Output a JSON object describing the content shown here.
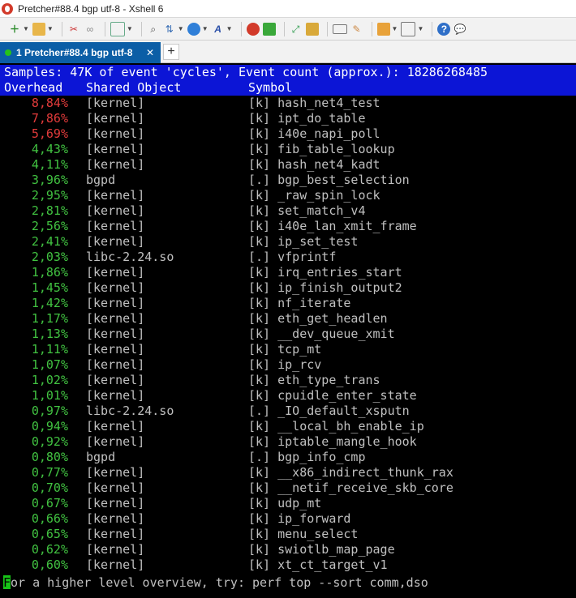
{
  "window": {
    "title": "Pretcher#88.4 bgp  utf-8 - Xshell 6"
  },
  "toolbar": {
    "icons": [
      "new-session",
      "open-folder",
      "disconnect",
      "reconnect",
      "properties",
      "find",
      "transfer",
      "globe",
      "font",
      "xftp",
      "xshell-shell",
      "fullscreen",
      "lock",
      "keyboard",
      "script",
      "new-tab",
      "layout",
      "help",
      "chat"
    ]
  },
  "tabs": [
    {
      "label": "1 Pretcher#88.4 bgp  utf-8",
      "close": "✕"
    }
  ],
  "tab_add": "+",
  "terminal": {
    "samples_line": "Samples: 47K of event 'cycles', Event count (approx.): 18286268485",
    "columns": {
      "overhead": "Overhead",
      "shared_object": "Shared Object",
      "symbol": "Symbol"
    },
    "rows": [
      {
        "pct": "8,84%",
        "obj": "[kernel]",
        "sym": "[k] hash_net4_test",
        "color": "red"
      },
      {
        "pct": "7,86%",
        "obj": "[kernel]",
        "sym": "[k] ipt_do_table",
        "color": "red"
      },
      {
        "pct": "5,69%",
        "obj": "[kernel]",
        "sym": "[k] i40e_napi_poll",
        "color": "red"
      },
      {
        "pct": "4,43%",
        "obj": "[kernel]",
        "sym": "[k] fib_table_lookup",
        "color": "green"
      },
      {
        "pct": "4,11%",
        "obj": "[kernel]",
        "sym": "[k] hash_net4_kadt",
        "color": "green"
      },
      {
        "pct": "3,96%",
        "obj": "bgpd",
        "sym": "[.] bgp_best_selection",
        "color": "green"
      },
      {
        "pct": "2,95%",
        "obj": "[kernel]",
        "sym": "[k] _raw_spin_lock",
        "color": "green"
      },
      {
        "pct": "2,81%",
        "obj": "[kernel]",
        "sym": "[k] set_match_v4",
        "color": "green"
      },
      {
        "pct": "2,56%",
        "obj": "[kernel]",
        "sym": "[k] i40e_lan_xmit_frame",
        "color": "green"
      },
      {
        "pct": "2,41%",
        "obj": "[kernel]",
        "sym": "[k] ip_set_test",
        "color": "green"
      },
      {
        "pct": "2,03%",
        "obj": "libc-2.24.so",
        "sym": "[.] vfprintf",
        "color": "green"
      },
      {
        "pct": "1,86%",
        "obj": "[kernel]",
        "sym": "[k] irq_entries_start",
        "color": "green"
      },
      {
        "pct": "1,45%",
        "obj": "[kernel]",
        "sym": "[k] ip_finish_output2",
        "color": "green"
      },
      {
        "pct": "1,42%",
        "obj": "[kernel]",
        "sym": "[k] nf_iterate",
        "color": "green"
      },
      {
        "pct": "1,17%",
        "obj": "[kernel]",
        "sym": "[k] eth_get_headlen",
        "color": "green"
      },
      {
        "pct": "1,13%",
        "obj": "[kernel]",
        "sym": "[k] __dev_queue_xmit",
        "color": "green"
      },
      {
        "pct": "1,11%",
        "obj": "[kernel]",
        "sym": "[k] tcp_mt",
        "color": "green"
      },
      {
        "pct": "1,07%",
        "obj": "[kernel]",
        "sym": "[k] ip_rcv",
        "color": "green"
      },
      {
        "pct": "1,02%",
        "obj": "[kernel]",
        "sym": "[k] eth_type_trans",
        "color": "green"
      },
      {
        "pct": "1,01%",
        "obj": "[kernel]",
        "sym": "[k] cpuidle_enter_state",
        "color": "green"
      },
      {
        "pct": "0,97%",
        "obj": "libc-2.24.so",
        "sym": "[.] _IO_default_xsputn",
        "color": "green"
      },
      {
        "pct": "0,94%",
        "obj": "[kernel]",
        "sym": "[k] __local_bh_enable_ip",
        "color": "green"
      },
      {
        "pct": "0,92%",
        "obj": "[kernel]",
        "sym": "[k] iptable_mangle_hook",
        "color": "green"
      },
      {
        "pct": "0,80%",
        "obj": "bgpd",
        "sym": "[.] bgp_info_cmp",
        "color": "green"
      },
      {
        "pct": "0,77%",
        "obj": "[kernel]",
        "sym": "[k] __x86_indirect_thunk_rax",
        "color": "green"
      },
      {
        "pct": "0,70%",
        "obj": "[kernel]",
        "sym": "[k] __netif_receive_skb_core",
        "color": "green"
      },
      {
        "pct": "0,67%",
        "obj": "[kernel]",
        "sym": "[k] udp_mt",
        "color": "green"
      },
      {
        "pct": "0,66%",
        "obj": "[kernel]",
        "sym": "[k] ip_forward",
        "color": "green"
      },
      {
        "pct": "0,65%",
        "obj": "[kernel]",
        "sym": "[k] menu_select",
        "color": "green"
      },
      {
        "pct": "0,62%",
        "obj": "[kernel]",
        "sym": "[k] swiotlb_map_page",
        "color": "green"
      },
      {
        "pct": "0,60%",
        "obj": "[kernel]",
        "sym": "[k] xt_ct_target_v1",
        "color": "green"
      }
    ],
    "hint_first": "F",
    "hint_rest": "or a higher level overview, try: perf top --sort comm,dso"
  },
  "colors": {
    "header_bg": "#0c15d6",
    "tab_active": "#0b5ea6",
    "cursor": "#17c417"
  }
}
